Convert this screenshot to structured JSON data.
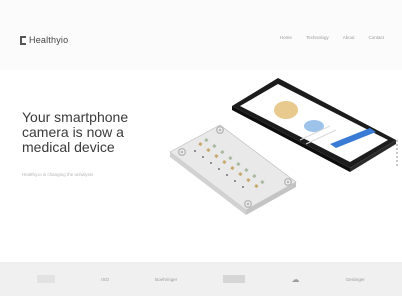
{
  "header": {
    "brand": "Healthyio",
    "nav": [
      "Home",
      "Technology",
      "About",
      "Contact"
    ]
  },
  "hero": {
    "headline_lines": [
      "Your smartphone",
      "camera is now a",
      "medical device"
    ],
    "subline": "Healthy.io is changing the urinalysis"
  },
  "partners": [
    "",
    "ISO",
    "Boehringer",
    "",
    "",
    "Geisinger"
  ],
  "colors": {
    "accent_blue": "#3a7bd5",
    "phone_body": "#1c1c1c",
    "background": "#ffffff",
    "partner_strip": "#f0f0f0"
  }
}
